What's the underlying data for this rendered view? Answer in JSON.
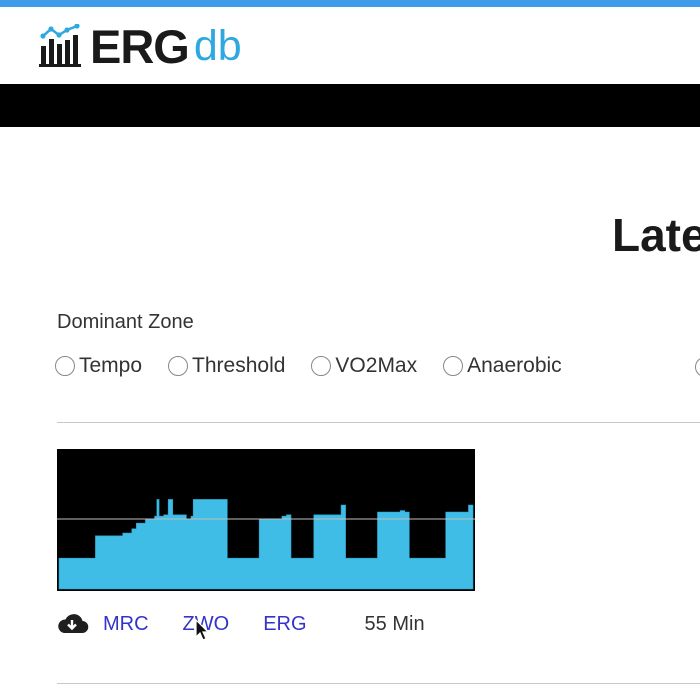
{
  "header": {
    "logo_main": "ERG",
    "logo_sub": "db",
    "accent_color": "#2ea8df",
    "top_strip_color": "#3d9be9",
    "logo_icon": "bar-chart-line-icon"
  },
  "page": {
    "heading": "Late"
  },
  "filters": {
    "label": "Dominant Zone",
    "options": [
      {
        "label": "Tempo",
        "selected": false
      },
      {
        "label": "Threshold",
        "selected": false
      },
      {
        "label": "VO2Max",
        "selected": false
      },
      {
        "label": "Anaerobic",
        "selected": false
      }
    ]
  },
  "workout": {
    "chart_colors": {
      "background": "#000000",
      "fill": "#3fbde6",
      "ftp_line": "#bfbfbf"
    },
    "power_profile": [
      [
        0,
        0.22
      ],
      [
        8,
        0.38
      ],
      [
        14,
        0.4
      ],
      [
        16,
        0.43
      ],
      [
        17,
        0.47
      ],
      [
        19,
        0.5
      ],
      [
        21,
        0.52
      ],
      [
        21.5,
        0.64
      ],
      [
        22,
        0.52
      ],
      [
        23,
        0.53
      ],
      [
        24,
        0.64
      ],
      [
        25,
        0.53
      ],
      [
        28,
        0.5
      ],
      [
        29,
        0.52
      ],
      [
        29.5,
        0.64
      ],
      [
        37,
        0.22
      ],
      [
        44,
        0.5
      ],
      [
        49,
        0.52
      ],
      [
        50,
        0.53
      ],
      [
        51,
        0.22
      ],
      [
        56,
        0.53
      ],
      [
        61,
        0.53
      ],
      [
        62,
        0.6
      ],
      [
        63,
        0.22
      ],
      [
        70,
        0.55
      ],
      [
        75,
        0.56
      ],
      [
        76,
        0.55
      ],
      [
        77,
        0.22
      ],
      [
        85,
        0.55
      ],
      [
        90,
        0.6
      ],
      [
        91,
        0.22
      ]
    ],
    "profile_units": {
      "x": "minutes (approx)",
      "y": "fraction of chart height"
    },
    "ftp_level": 0.5,
    "download_icon": "cloud-download-icon",
    "formats": [
      "MRC",
      "ZWO",
      "ERG"
    ],
    "duration": "55 Min"
  },
  "cursor": "pointer-cursor-icon"
}
